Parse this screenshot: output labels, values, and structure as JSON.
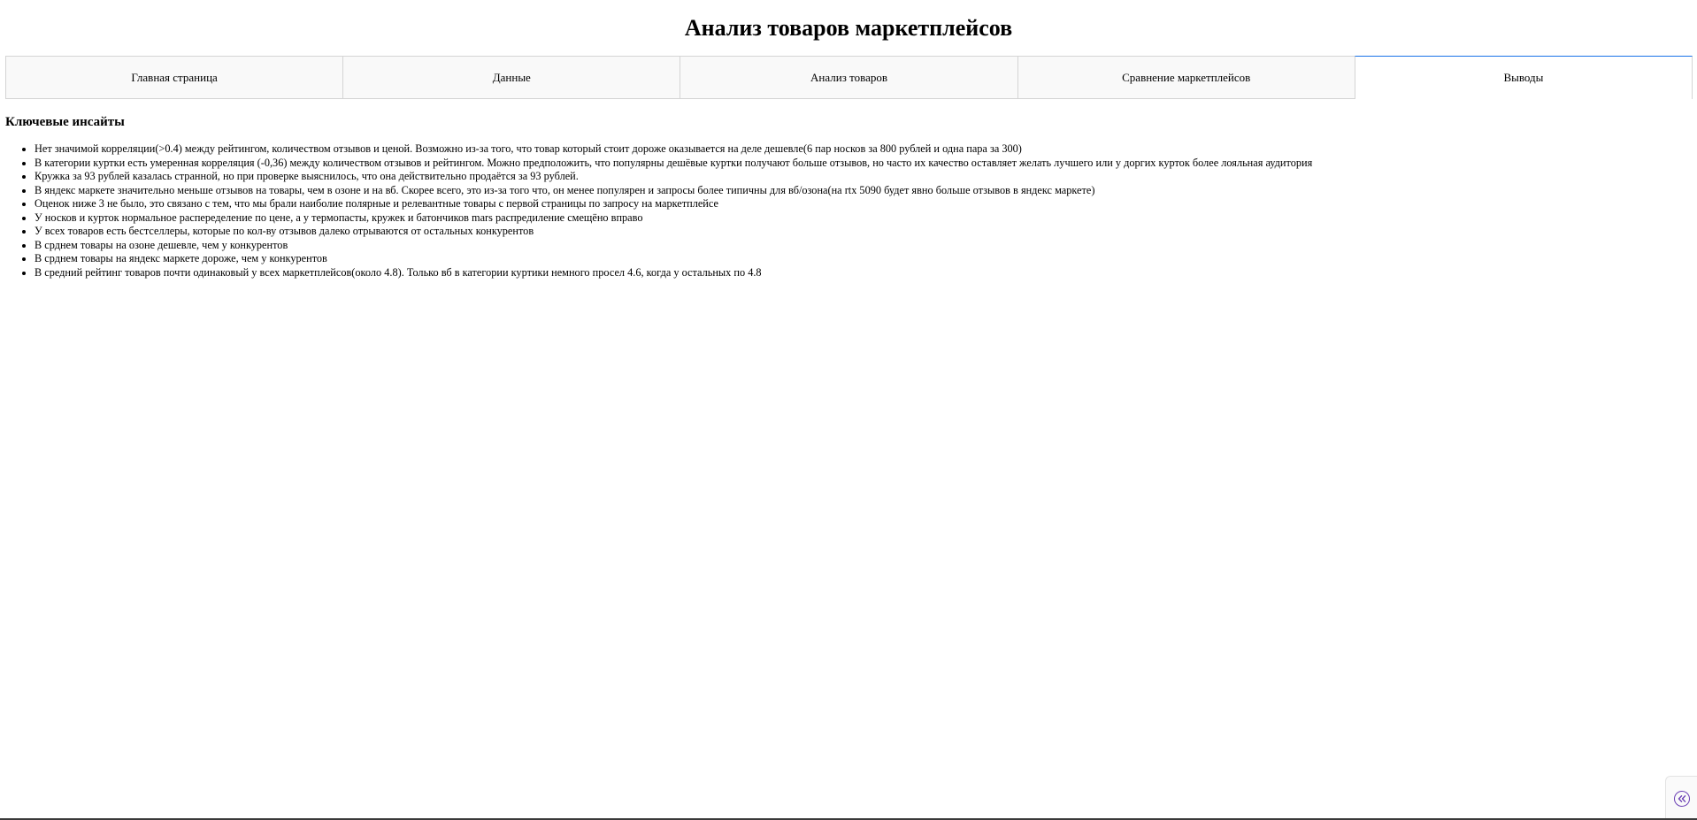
{
  "page": {
    "title": "Анализ товаров маркетплейсов"
  },
  "tabs": [
    {
      "label": "Главная страница",
      "active": false
    },
    {
      "label": "Данные",
      "active": false
    },
    {
      "label": "Анализ товаров",
      "active": false
    },
    {
      "label": "Сравнение маркетплейсов",
      "active": false
    },
    {
      "label": "Выводы",
      "active": true
    }
  ],
  "insights": {
    "heading": "Ключевые инсайты",
    "items": [
      "Нет значимой корреляции(>0.4) между рейтингом, количеством отзывов и ценой. Возможно из-за того, что товар который стоит дороже оказывается на деле дешевле(6 пар носков за 800 рублей и одна пара за 300)",
      "В категории куртки есть умеренная корреляция (-0,36) между количеством отзывов и рейтингом. Можно предположить, что популярны дешёвые куртки получают больше отзывов, но часто их качество оставляет желать лучшего или у доргих курток более лояльная аудитория",
      "Кружка за 93 рублей казалась странной, но при проверке выяснилось, что она действительно продаётся за 93 рублей.",
      "В яндекс маркете значительно меньше отзывов на товары, чем в озоне и на вб. Скорее всего, это из-за того что, он менее популярен и запросы более типичны для вб/озона(на rtx 5090 будет явно больше отзывов в яндекс маркете)",
      "Оценок ниже 3 не было, это связано с тем, что мы брали наиболие полярные и релевантные товары с первой страницы по запросу на маркетплейсе",
      "У носков и курток нормальное распеределение по цене, а у термопасты, кружек и батончиков mars распредиление смещёно вправо",
      "У всех товаров есть бестселлеры, которые по кол-ву отзывов далеко отрываются от остальных конкурентов",
      "В срднем товары на озоне дешевле, чем у конкурентов",
      "В срднем товары на яндекс маркете дороже, чем у конкурентов",
      "В средний рейтинг товаров почти одинаковый у всех маркетплейсов(около 4.8). Только вб в категории куртики немного просел 4.6, когда у остальных по 4.8"
    ]
  },
  "sidebar_toggle": {
    "icon": "double-chevron-left-icon",
    "color": "#6b3fb5"
  },
  "colors": {
    "active_tab_accent": "#1a73e8",
    "tab_background": "#f9f9f9",
    "border": "#d4d4d4"
  }
}
